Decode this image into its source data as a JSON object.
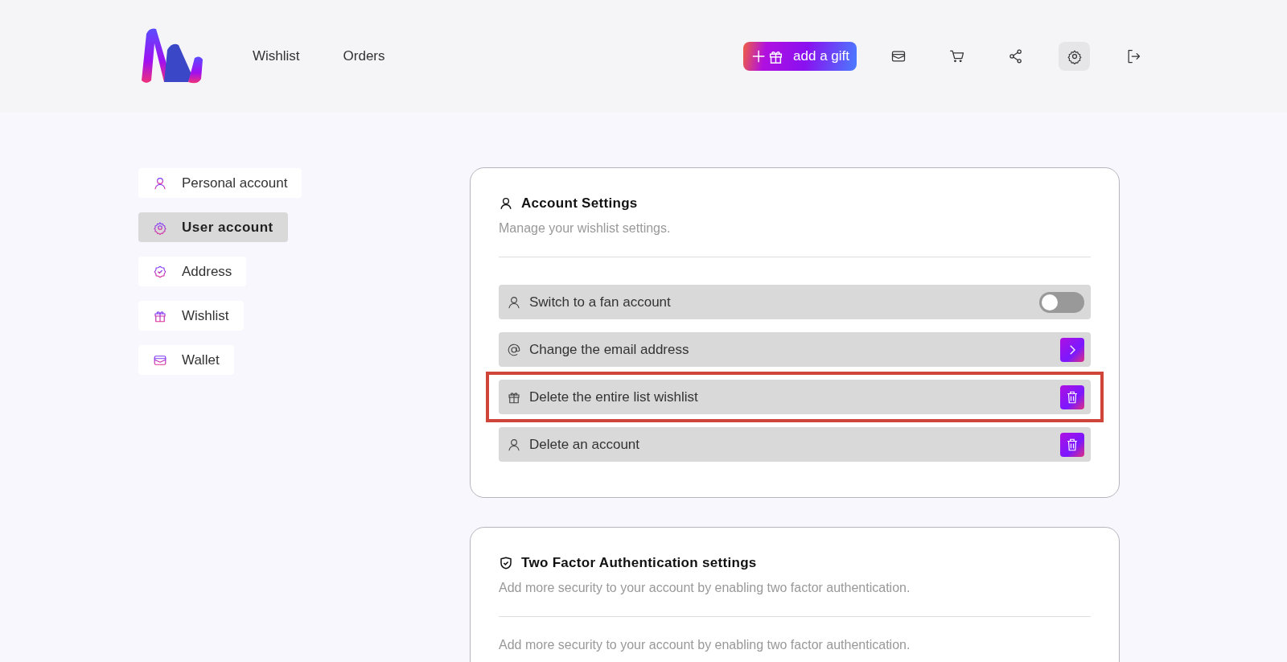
{
  "header": {
    "nav": [
      {
        "label": "Wishlist"
      },
      {
        "label": "Orders"
      }
    ],
    "add_gift": {
      "label": "add a gift"
    },
    "icons": [
      {
        "kind": "wallet",
        "selected": false
      },
      {
        "kind": "cart",
        "selected": false
      },
      {
        "kind": "share",
        "selected": false
      },
      {
        "kind": "settings",
        "selected": true
      },
      {
        "kind": "logout",
        "selected": false
      }
    ]
  },
  "sidebar": {
    "items": [
      {
        "label": "Personal account",
        "kind": "user",
        "selected": false
      },
      {
        "label": "User account",
        "kind": "settings",
        "selected": true
      },
      {
        "label": "Address",
        "kind": "badge",
        "selected": false
      },
      {
        "label": "Wishlist",
        "kind": "gift",
        "selected": false
      },
      {
        "label": "Wallet",
        "kind": "wallet",
        "selected": false
      }
    ]
  },
  "account_settings": {
    "title": "Account Settings",
    "subtitle": "Manage your wishlist settings.",
    "rows": [
      {
        "label": "Switch to a fan account",
        "kind": "toggle",
        "on": false,
        "highlighted": false
      },
      {
        "label": "Change the email address",
        "kind": "arrow",
        "highlighted": false
      },
      {
        "label": "Delete the entire list wishlist",
        "kind": "delete",
        "highlighted": true
      },
      {
        "label": "Delete an account",
        "kind": "delete",
        "highlighted": false
      }
    ]
  },
  "two_factor": {
    "title": "Two Factor Authentication settings",
    "subtitle": "Add more security to your account by enabling two factor authentication.",
    "body": "Add more security to your account by enabling two factor authentication."
  }
}
